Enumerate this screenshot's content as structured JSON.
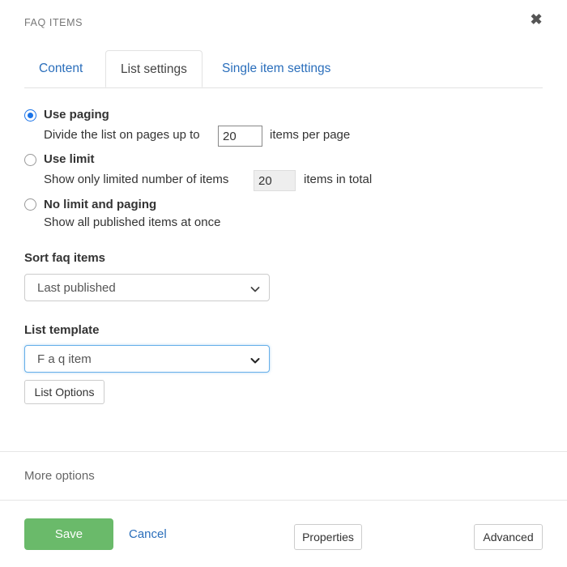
{
  "header": {
    "title": "FAQ ITEMS",
    "close_icon": "close-icon",
    "close_glyph": "✖"
  },
  "tabs": [
    {
      "label": "Content",
      "active": false
    },
    {
      "label": "List settings",
      "active": true
    },
    {
      "label": "Single item settings",
      "active": false
    }
  ],
  "paging_options": [
    {
      "title": "Use paging",
      "description_before": "Divide the list on pages up to",
      "input_value": "20",
      "description_after": "items per page",
      "selected": true,
      "input_disabled": false
    },
    {
      "title": "Use limit",
      "description_before": "Show only limited number of items",
      "input_value": "20",
      "description_after": "items in total",
      "selected": false,
      "input_disabled": true
    },
    {
      "title": "No limit and paging",
      "description_before": "Show all published items at once",
      "input_value": "",
      "description_after": "",
      "selected": false,
      "input_disabled": false
    }
  ],
  "sort_field": {
    "label": "Sort faq items",
    "value": "Last published",
    "icon": "chevron-down-icon"
  },
  "template_field": {
    "label": "List template",
    "value": "F a q item",
    "icon": "chevron-down-icon",
    "focused": true
  },
  "list_options_button": "List Options",
  "footer": {
    "more_options": "More options",
    "save": "Save",
    "cancel": "Cancel",
    "properties": "Properties",
    "advanced": "Advanced"
  },
  "colors": {
    "accent_link": "#2a6ebb",
    "save_green": "#6aba6a",
    "radio_blue": "#1a73e8",
    "focus_blue": "#66afe9",
    "border_grey": "#cccccc"
  }
}
